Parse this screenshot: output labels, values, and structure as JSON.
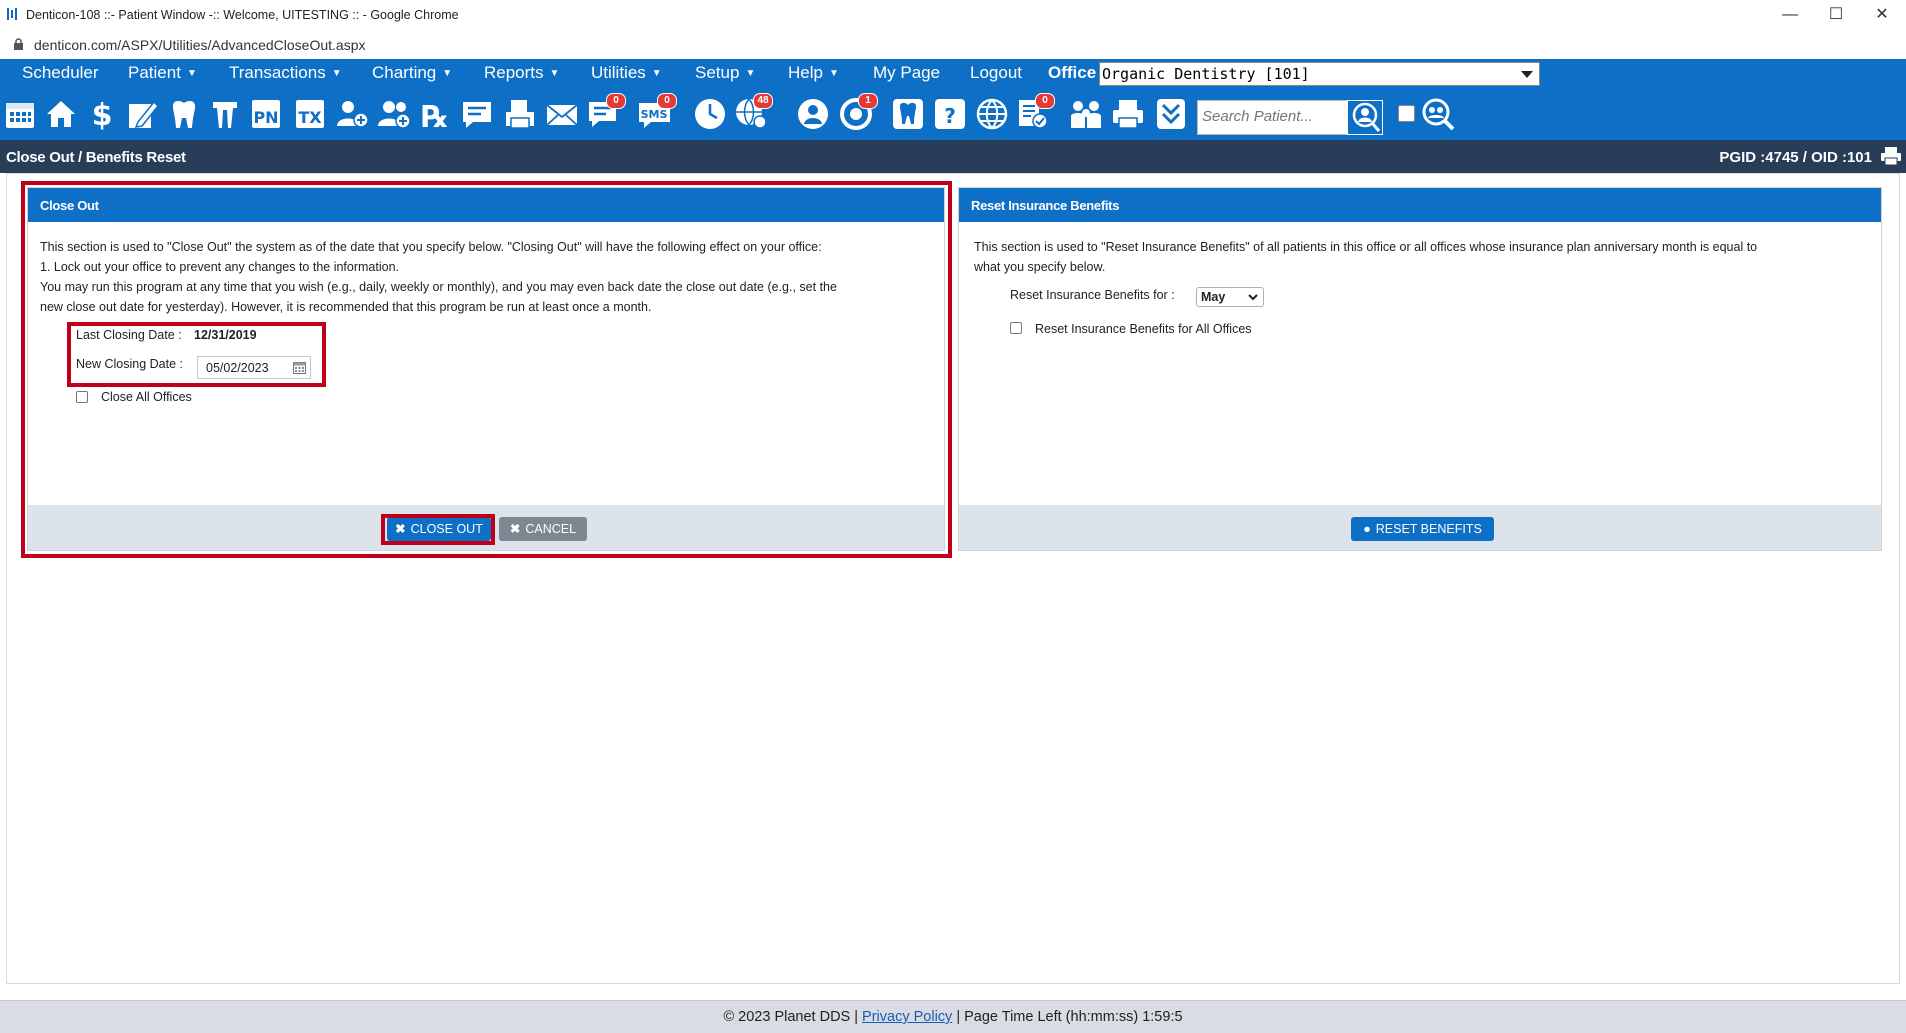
{
  "window": {
    "title": "Denticon-108 ::- Patient Window -:: Welcome, UITESTING :: - Google Chrome"
  },
  "browser": {
    "url": "denticon.com/ASPX/Utilities/AdvancedCloseOut.aspx"
  },
  "menu": {
    "items": [
      {
        "label": "Scheduler",
        "dropdown": false
      },
      {
        "label": "Patient",
        "dropdown": true
      },
      {
        "label": "Transactions",
        "dropdown": true
      },
      {
        "label": "Charting",
        "dropdown": true
      },
      {
        "label": "Reports",
        "dropdown": true
      },
      {
        "label": "Utilities",
        "dropdown": true
      },
      {
        "label": "Setup",
        "dropdown": true
      },
      {
        "label": "Help",
        "dropdown": true
      },
      {
        "label": "My Page",
        "dropdown": false
      },
      {
        "label": "Logout",
        "dropdown": false
      }
    ],
    "office_label": "Office",
    "office_value": "Organic Dentistry [101]"
  },
  "toolbar": {
    "search_placeholder": "Search Patient...",
    "badges": {
      "messages": "0",
      "sms": "0",
      "web": "48",
      "alerts": "1",
      "tasks": "0"
    },
    "icons": [
      "calendar-icon",
      "home-icon",
      "dollar-icon",
      "notes-icon",
      "tooth-icon",
      "teeth-icon",
      "pn-icon",
      "tx-icon",
      "add-patient-icon",
      "patient-group-icon",
      "rx-icon",
      "chat-icon",
      "print-fax-icon",
      "mail-icon",
      "message-icon",
      "sms-icon",
      "clock-icon",
      "globe-users-icon",
      "support-icon",
      "alert-icon",
      "tooth-chart-icon",
      "help-tooth-icon",
      "globe-icon",
      "document-check-icon",
      "family-icon",
      "printer-icon",
      "download-icon",
      "user-search-icon",
      "group-search-icon"
    ]
  },
  "page": {
    "title": "Close Out / Benefits Reset",
    "pgid": "PGID :4745  /  OID :101"
  },
  "close_out": {
    "heading": "Close Out",
    "description_lines": [
      "This section is used to \"Close Out\" the system as of the date that you specify below. \"Closing Out\" will have the following effect on your office:",
      "1. Lock out your office to prevent any changes to the information.",
      "You may run this program at any time that you wish (e.g., daily, weekly or monthly), and you may even back date the close out date (e.g., set the",
      "new close out date for yesterday). However, it is recommended that this program be run at least once a month."
    ],
    "last_closing_label": "Last Closing Date :",
    "last_closing_value": "12/31/2019",
    "new_closing_label": "New Closing Date :",
    "new_closing_value": "05/02/2023",
    "close_all_label": "Close All Offices",
    "close_all_checked": false,
    "close_out_button": "CLOSE OUT",
    "cancel_button": "CANCEL"
  },
  "reset_benefits": {
    "heading": "Reset Insurance Benefits",
    "description_lines": [
      "This section is used to \"Reset Insurance Benefits\" of all patients in this office or all offices whose insurance plan anniversary month is equal to",
      "what you specify below."
    ],
    "reset_for_label": "Reset Insurance Benefits for :",
    "month_value": "May",
    "all_offices_label": "Reset Insurance Benefits for All Offices",
    "all_offices_checked": false,
    "reset_button": "RESET BENEFITS"
  },
  "footer": {
    "copyright": "© 2023 Planet DDS |",
    "privacy": "Privacy Policy",
    "time_left_label": "|  Page Time Left (hh:mm:ss)",
    "time_left_value": "1:59:5"
  },
  "colors": {
    "primary_blue": "#0e6fc7",
    "header_navy": "#273d58",
    "highlight_red": "#c0001a",
    "cancel_gray": "#7c8791",
    "panel_footer": "#dde3ea"
  }
}
